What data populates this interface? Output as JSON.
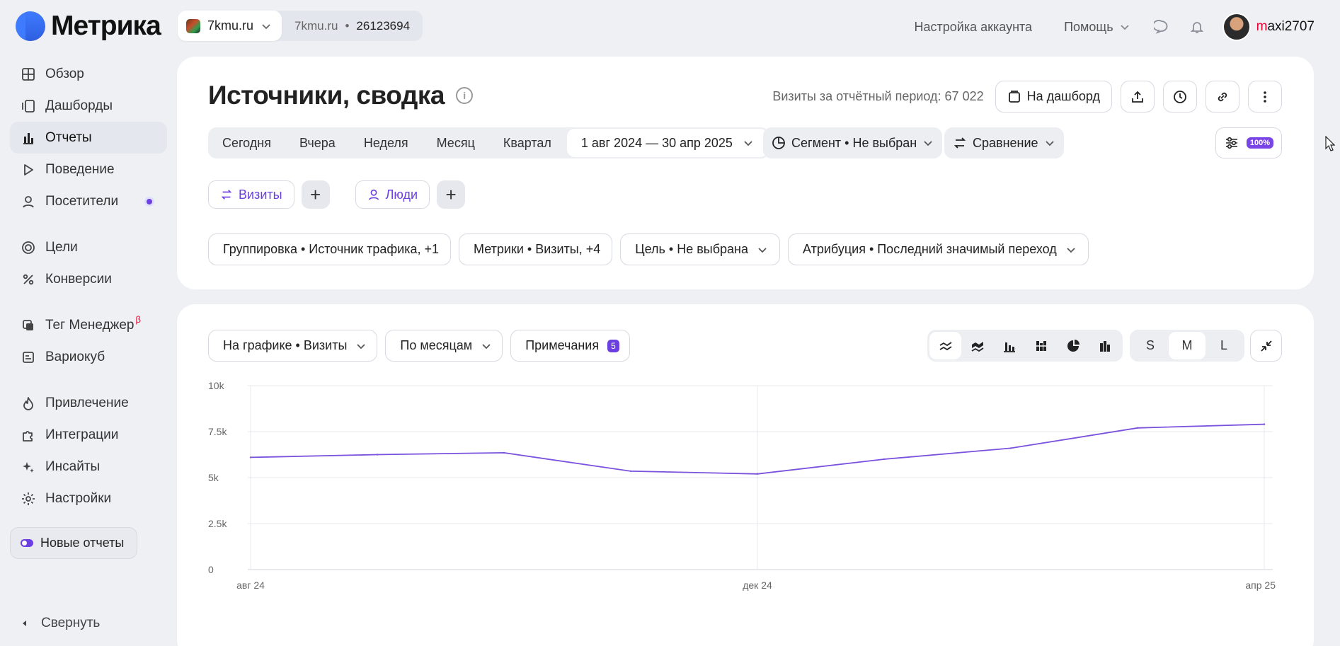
{
  "app": {
    "logo_text": "Метрика"
  },
  "counter": {
    "site": "7kmu.ru",
    "site_short": "7kmu.ru",
    "separator": "•",
    "id": "26123694"
  },
  "topbar": {
    "account_settings": "Настройка аккаунта",
    "help": "Помощь",
    "user_prefix": "m",
    "user_rest": "axi2707"
  },
  "sidebar": {
    "items": [
      {
        "label": "Обзор",
        "icon": "grid-icon"
      },
      {
        "label": "Дашборды",
        "icon": "dashboards-icon"
      },
      {
        "label": "Отчеты",
        "icon": "bar-chart-icon",
        "active": true
      },
      {
        "label": "Поведение",
        "icon": "play-icon"
      },
      {
        "label": "Посетители",
        "icon": "person-icon"
      },
      {
        "label": "Цели",
        "icon": "target-icon"
      },
      {
        "label": "Конверсии",
        "icon": "percent-icon"
      },
      {
        "label": "Тег Менеджер",
        "icon": "tag-manager-icon",
        "sup": "β"
      },
      {
        "label": "Вариокуб",
        "icon": "variocube-icon"
      },
      {
        "label": "Привлечение",
        "icon": "flame-icon"
      },
      {
        "label": "Интеграции",
        "icon": "puzzle-icon"
      },
      {
        "label": "Инсайты",
        "icon": "sparkle-icon"
      },
      {
        "label": "Настройки",
        "icon": "gear-icon"
      }
    ],
    "new_reports": "Новые отчеты",
    "collapse": "Свернуть"
  },
  "report": {
    "title": "Источники, сводка",
    "visits_total": "Визиты за отчётный период: 67 022",
    "to_dashboard": "На дашборд",
    "periods": [
      "Сегодня",
      "Вчера",
      "Неделя",
      "Месяц",
      "Квартал"
    ],
    "date_range": "1 авг 2024 — 30 апр 2025",
    "segment": "Сегмент • Не выбран",
    "compare": "Сравнение",
    "sampling": "100%",
    "chips": {
      "visits": "Визиты",
      "people": "Люди"
    },
    "filters": [
      "Группировка • Источник трафика, +1",
      "Метрики • Визиты, +4",
      "Цель • Не выбрана",
      "Атрибуция • Последний значимый переход"
    ]
  },
  "chart_panel": {
    "metric_dd": "На графике • Визиты",
    "period_dd": "По месяцам",
    "notes": "Примечания",
    "notes_count": "5",
    "sizes": [
      "S",
      "M",
      "L"
    ],
    "active_size": "M"
  },
  "chart_data": {
    "type": "line",
    "x": [
      "авг 24",
      "сен 24",
      "окт 24",
      "ноя 24",
      "дек 24",
      "янв 25",
      "фев 25",
      "мар 25",
      "апр 25"
    ],
    "x_tick_labels": [
      "авг 24",
      "дек 24",
      "апр 25"
    ],
    "series": [
      {
        "values": [
          6100,
          6250,
          6350,
          5350,
          5200,
          6000,
          6600,
          7700,
          7900
        ],
        "color": "#7a52de"
      }
    ],
    "y_ticks": [
      "0",
      "2.5k",
      "5k",
      "7.5k",
      "10k"
    ],
    "ylim": [
      0,
      10000
    ],
    "grid": true
  },
  "colors": {
    "accent": "#6c3fe0",
    "background": "#eef0f4"
  }
}
